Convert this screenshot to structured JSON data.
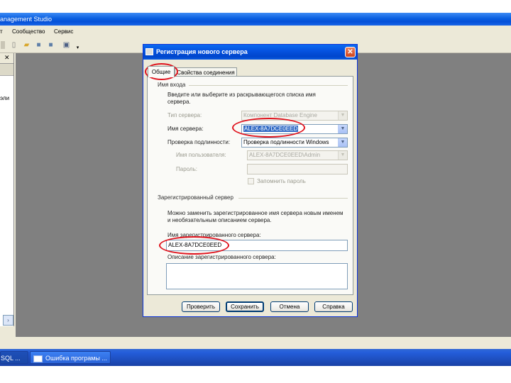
{
  "app": {
    "title": "anagement Studio",
    "menu": [
      "т",
      "Сообщество",
      "Сервис"
    ]
  },
  "left_pane": {
    "close_glyph": "✕",
    "text": "эли"
  },
  "taskbar": {
    "items": [
      "SQL ...",
      "Ошибка програмы ..."
    ]
  },
  "dialog": {
    "title": "Регистрация нового сервера",
    "close_glyph": "✕",
    "tabs": [
      "Общие",
      "Свойства соединения"
    ],
    "login_group": {
      "title": "Имя входа",
      "instruction": "Введите или выберите из раскрывающегося списка имя сервера.",
      "server_type": {
        "label": "Тип сервера:",
        "value": "Компонент Database Engine"
      },
      "server_name": {
        "label": "Имя сервера:",
        "value": "ALEX-8A7DCE0EED"
      },
      "authentication": {
        "label": "Проверка подлинности:",
        "value": "Проверка подлинности Windows"
      },
      "user_name": {
        "label": "Имя пользователя:",
        "value": "ALEX-8A7DCE0EED\\Admin"
      },
      "password": {
        "label": "Пароль:",
        "value": ""
      },
      "remember_password": {
        "label": "Запомнить пароль",
        "checked": false
      }
    },
    "registered_group": {
      "title": "Зарегистрированный сервер",
      "instruction": "Можно заменить зарегистрированное имя сервера новым именем и необязательным описанием сервера.",
      "registered_name": {
        "label": "Имя зарегистрированного сервера:",
        "value": "ALEX-8A7DCE0EED"
      },
      "description": {
        "label": "Описание зарегистрированного сервера:",
        "value": ""
      }
    },
    "buttons": {
      "test": "Проверить",
      "save": "Сохранить",
      "cancel": "Отмена",
      "help": "Справка"
    }
  },
  "annotations": {
    "color": "#e0141e"
  }
}
